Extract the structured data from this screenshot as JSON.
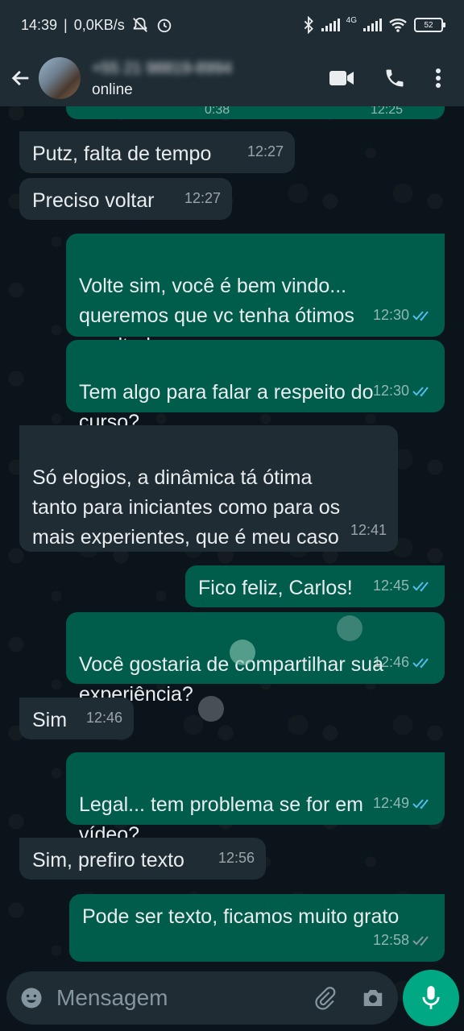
{
  "statusbar": {
    "time": "14:39",
    "network": "0,0KB/s",
    "lte": "4G",
    "battery": "52"
  },
  "header": {
    "contact_name": "+55 21 98819-8994",
    "status": "online"
  },
  "messages": [
    {
      "text": "Putz, falta de tempo",
      "time": "12:27",
      "dir": "in"
    },
    {
      "text": "Preciso voltar",
      "time": "12:27",
      "dir": "in"
    },
    {
      "text": "Volte sim, você é bem vindo...\nqueremos que vc tenha ótimos\nresultados",
      "time": "12:30",
      "dir": "out",
      "read": true
    },
    {
      "text": "Tem algo para falar a respeito do\ncurso?",
      "time": "12:30",
      "dir": "out",
      "read": true
    },
    {
      "text": "Só elogios, a dinâmica tá ótima\ntanto para iniciantes como para os\nmais experientes, que é meu caso",
      "time": "12:41",
      "dir": "in"
    },
    {
      "text": "Fico feliz, Carlos!",
      "time": "12:45",
      "dir": "out",
      "read": true
    },
    {
      "text": "Você gostaria de compartilhar sua\nexperiência?",
      "time": "12:46",
      "dir": "out",
      "read": true
    },
    {
      "text": "Sim",
      "time": "12:46",
      "dir": "in"
    },
    {
      "text": "Legal... tem problema se for em\nvídeo?",
      "time": "12:49",
      "dir": "out",
      "read": true
    },
    {
      "text": "Sim, prefiro texto",
      "time": "12:56",
      "dir": "in"
    },
    {
      "text": "Pode ser texto, ficamos muito grato",
      "time": "12:58",
      "dir": "out",
      "read": false
    }
  ],
  "partial_top_message": {
    "duration": "0:38",
    "time": "12:25"
  },
  "composer": {
    "placeholder": "Mensagem"
  },
  "colors": {
    "incoming": "#1f2c34",
    "outgoing": "#005c4b",
    "read_ticks": "#53bdeb",
    "accent": "#00a884"
  }
}
